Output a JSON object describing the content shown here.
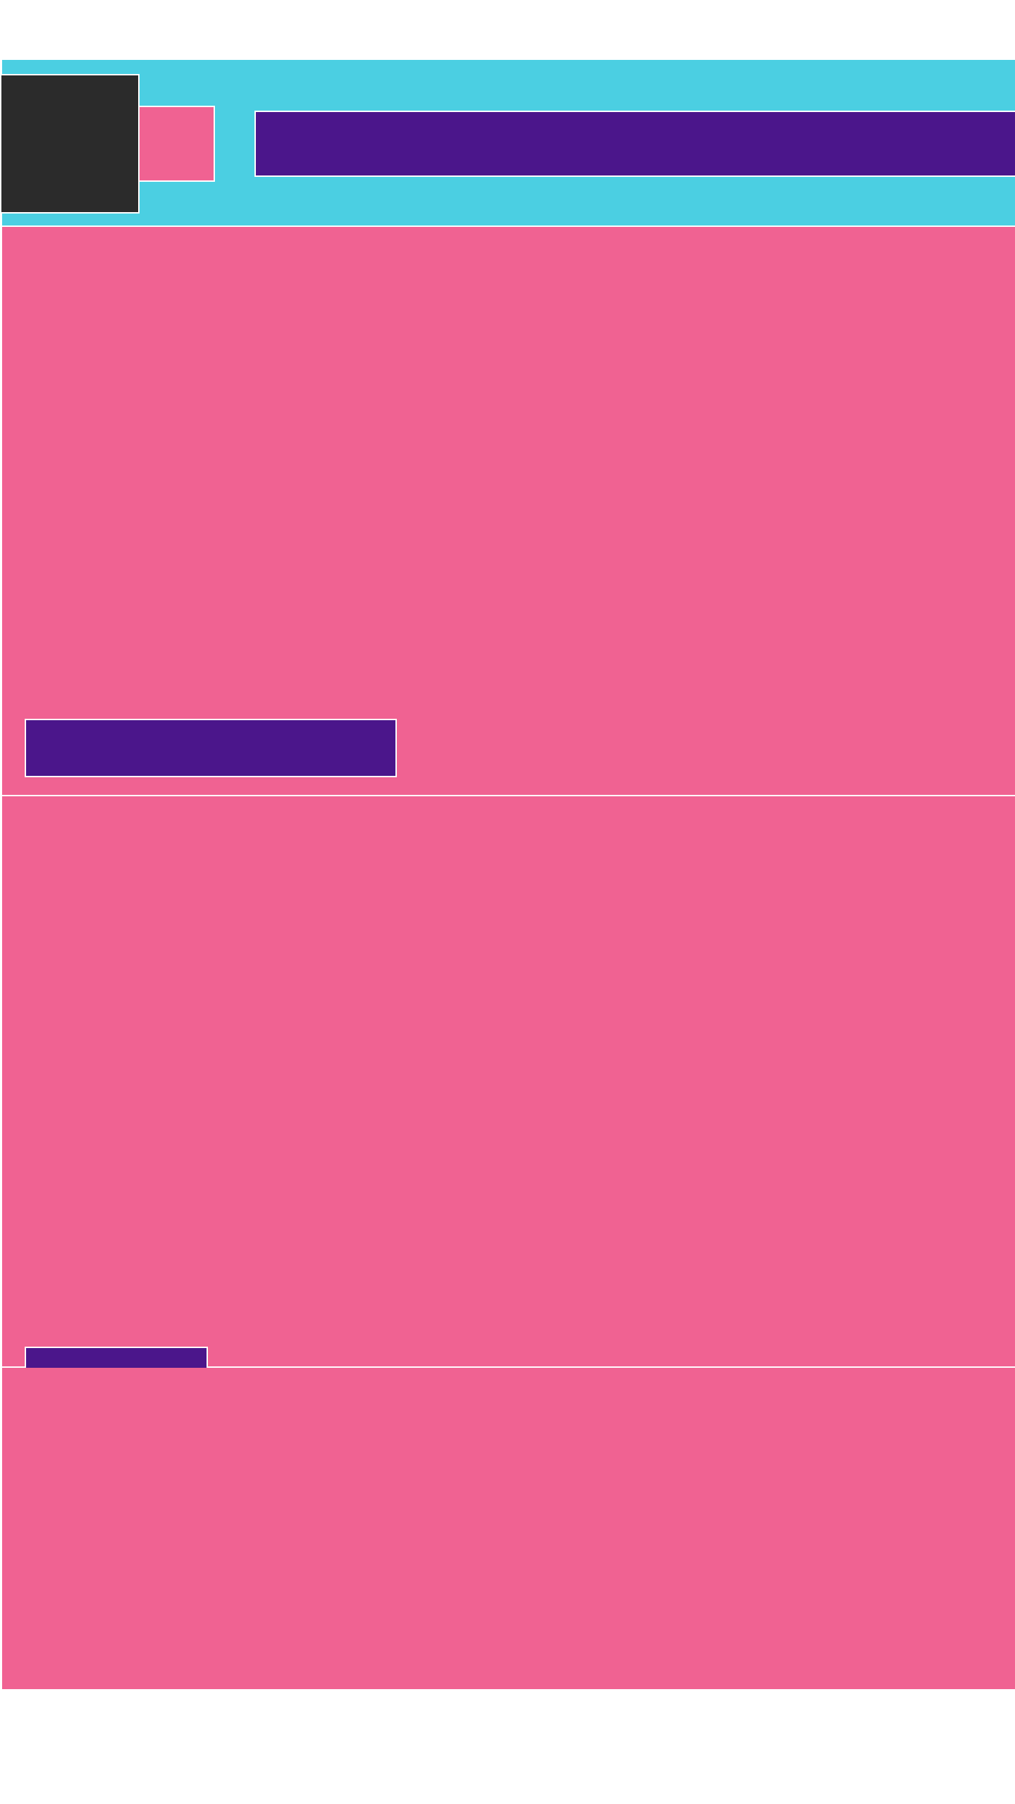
{
  "colors": {
    "header_bg": "#4bcfe2",
    "logo_bg": "#2b2b2b",
    "accent_pink": "#f06292",
    "purple": "#4b168b",
    "border": "#ffffff",
    "page_bg": "#ffffff"
  },
  "header": {
    "logo_text": "",
    "menu_icon": "menu-icon",
    "search": {
      "value": "",
      "placeholder": ""
    }
  },
  "sections": [
    {
      "cta_label": ""
    },
    {
      "cta_label": ""
    },
    {
      "cta_label": ""
    }
  ]
}
